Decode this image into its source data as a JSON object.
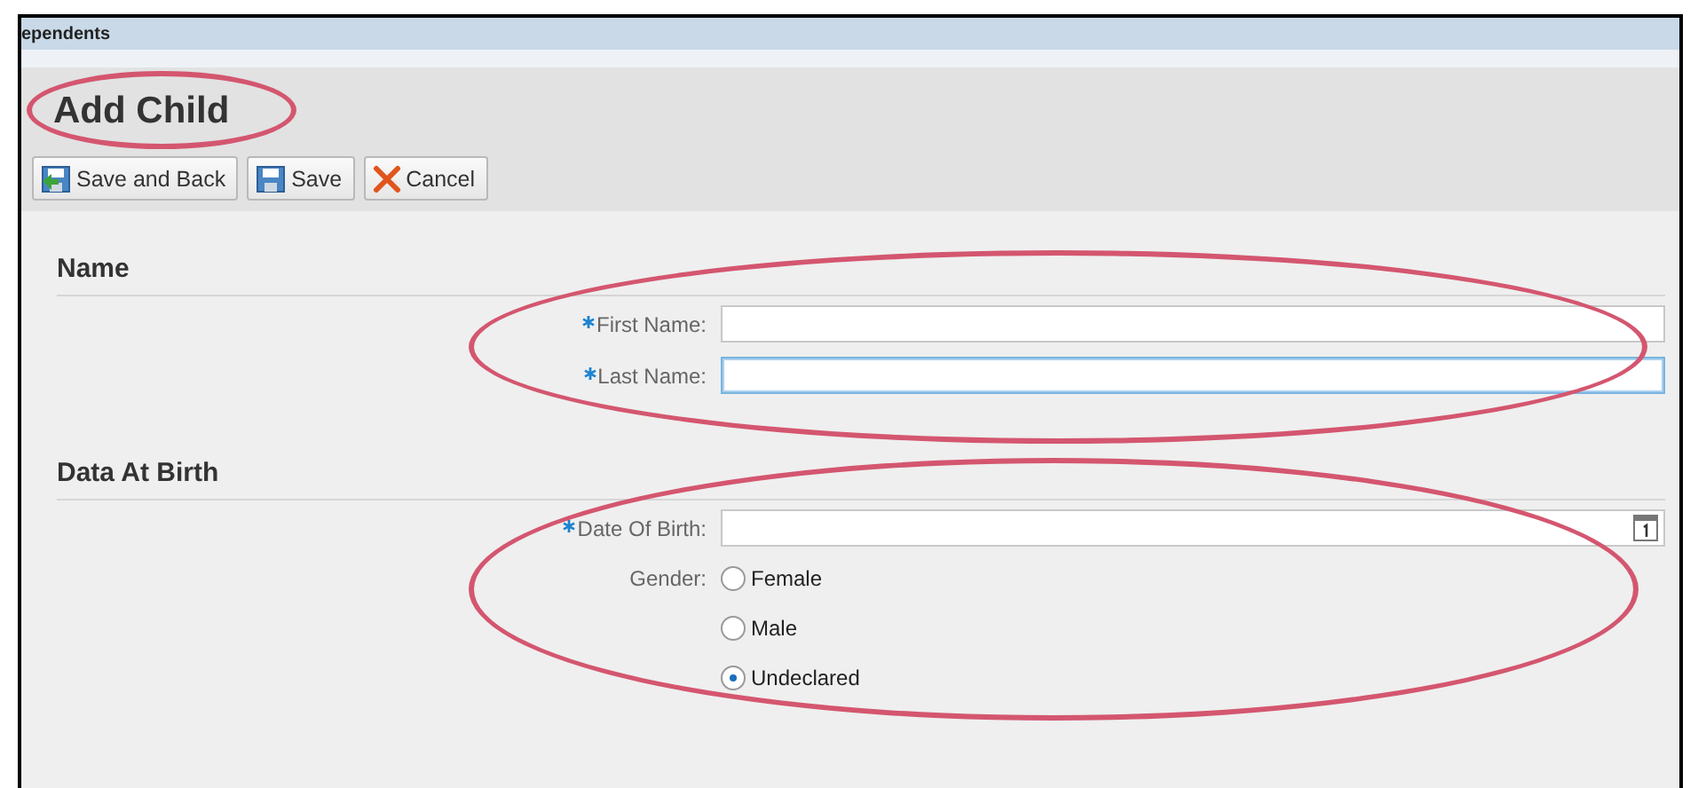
{
  "window": {
    "title": "ependents"
  },
  "page": {
    "title": "Add Child",
    "circled": true
  },
  "toolbar": [
    {
      "kind": "save-back",
      "label": "Save and Back"
    },
    {
      "kind": "save",
      "label": "Save"
    },
    {
      "kind": "cancel",
      "label": "Cancel"
    }
  ],
  "sections": [
    {
      "title": "Name",
      "circled": true,
      "fields": [
        {
          "kind": "text",
          "label": "First Name:",
          "required": true,
          "focused": false
        },
        {
          "kind": "text",
          "label": "Last Name:",
          "required": true,
          "focused": true
        }
      ]
    },
    {
      "title": "Data At Birth",
      "circled": true,
      "fields": [
        {
          "kind": "date",
          "label": "Date Of Birth:",
          "required": true,
          "focused": false
        },
        {
          "kind": "radio",
          "label": "Gender:",
          "required": false,
          "options": [
            {
              "label": "Female",
              "selected": false
            },
            {
              "label": "Male",
              "selected": false
            },
            {
              "label": "Undeclared",
              "selected": true
            }
          ]
        }
      ]
    }
  ]
}
